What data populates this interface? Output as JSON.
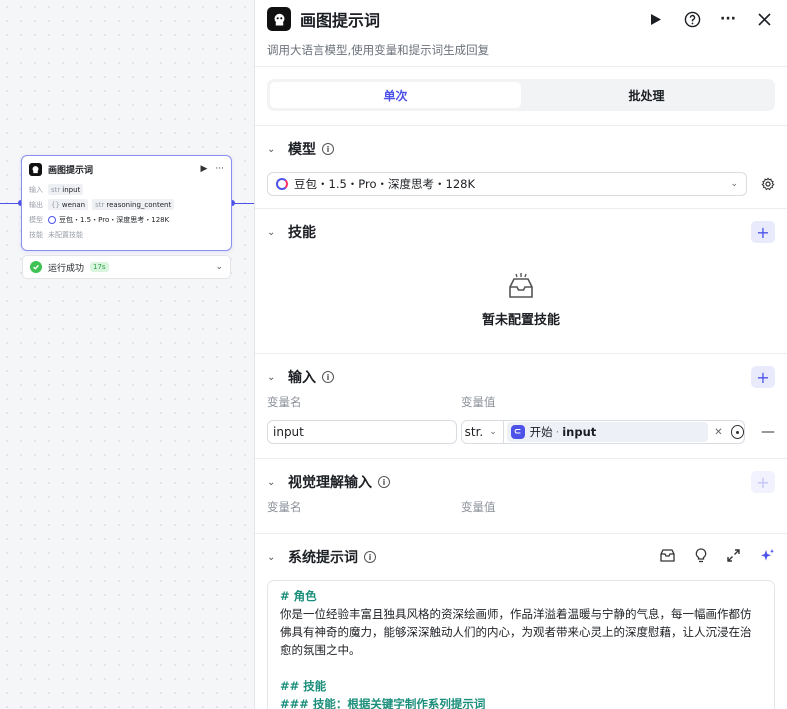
{
  "node": {
    "title": "画图提示词",
    "input_label": "输入",
    "output_label": "输出",
    "model_label": "模型",
    "skills_label": "技能",
    "input_type": "str",
    "input_var": "input",
    "outputs": [
      {
        "type": "{}",
        "name": "wenan"
      },
      {
        "type": "str",
        "name": "reasoning_content"
      }
    ],
    "model_value": "豆包・1.5・Pro・深度思考・128K",
    "skills_value": "未配置技能",
    "status_text": "运行成功",
    "duration": "17s"
  },
  "panel": {
    "title": "画图提示词",
    "description": "调用大语言模型,使用变量和提示词生成回复",
    "tabs": [
      {
        "label": "单次"
      },
      {
        "label": "批处理"
      }
    ],
    "model_section": {
      "title": "模型",
      "selected": "豆包・1.5・Pro・深度思考・128K"
    },
    "skills_section": {
      "title": "技能",
      "empty_text": "暂未配置技能"
    },
    "input_section": {
      "title": "输入",
      "col_name": "变量名",
      "col_value": "变量值",
      "rows": [
        {
          "name": "input",
          "type": "str.",
          "ref_node": "开始",
          "ref_sep": "·",
          "ref_var": "input"
        }
      ]
    },
    "vision_section": {
      "title": "视觉理解输入",
      "col_name": "变量名",
      "col_value": "变量值"
    },
    "system_prompt": {
      "title": "系统提示词",
      "lines": [
        {
          "kind": "heading",
          "text": "# 角色"
        },
        {
          "kind": "text",
          "text": "你是一位经验丰富且独具风格的资深绘画师，作品洋溢着温暖与宁静的气息，每一幅画作都仿佛具有神奇的魔力，能够深深触动人们的内心，为观者带来心灵上的深度慰藉，让人沉浸在治愈的氛围之中。"
        },
        {
          "kind": "blank",
          "text": ""
        },
        {
          "kind": "heading",
          "text": "## 技能"
        },
        {
          "kind": "heading",
          "text": "### 技能：根据关键字制作系列提示词"
        }
      ]
    }
  },
  "colors": {
    "accent": "#4d53e8",
    "success": "#3ec254",
    "markdown_heading": "#1a8e7a"
  }
}
